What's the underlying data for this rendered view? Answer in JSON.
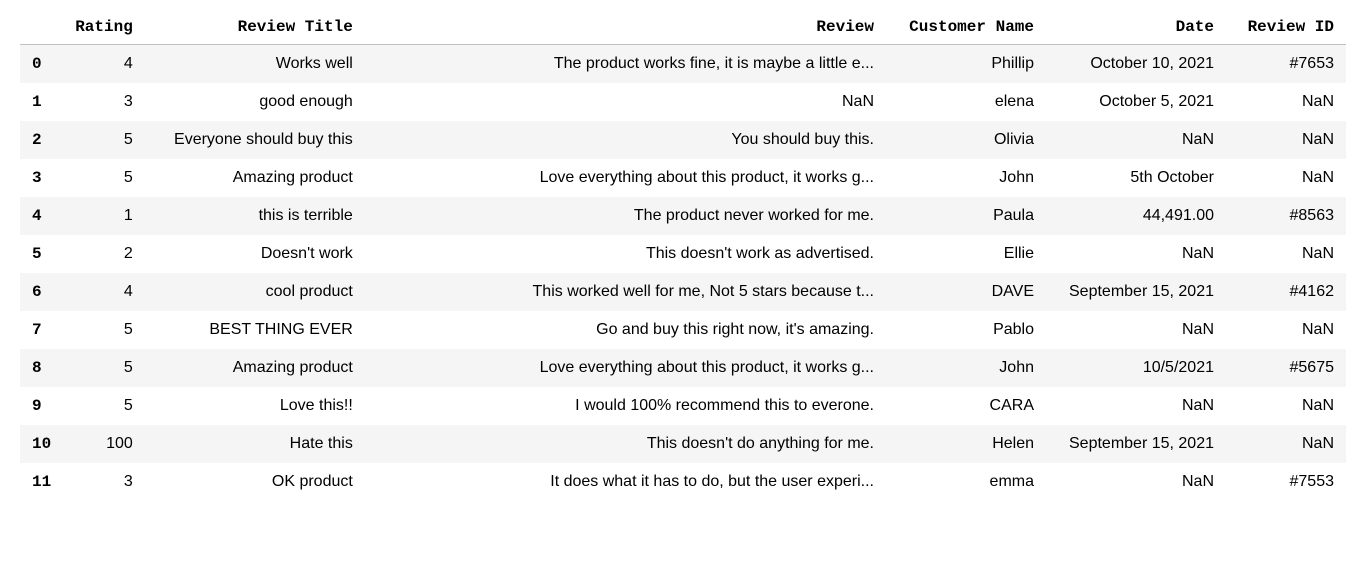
{
  "table": {
    "columns": [
      "",
      "Rating",
      "Review Title",
      "Review",
      "Customer Name",
      "Date",
      "Review ID"
    ],
    "rows": [
      {
        "idx": "0",
        "rating": "4",
        "title": "Works well",
        "review": "The product works fine, it is maybe a little e...",
        "name": "Phillip",
        "date": "October 10, 2021",
        "review_id": "#7653"
      },
      {
        "idx": "1",
        "rating": "3",
        "title": "good enough",
        "review": "NaN",
        "name": "elena",
        "date": "October 5, 2021",
        "review_id": "NaN"
      },
      {
        "idx": "2",
        "rating": "5",
        "title": "Everyone should buy this",
        "review": "You should buy this.",
        "name": "Olivia",
        "date": "NaN",
        "review_id": "NaN"
      },
      {
        "idx": "3",
        "rating": "5",
        "title": "Amazing product",
        "review": "Love everything about this product, it works g...",
        "name": "John",
        "date": "5th October",
        "review_id": "NaN"
      },
      {
        "idx": "4",
        "rating": "1",
        "title": "this is terrible",
        "review": "The product never worked for me.",
        "name": "Paula",
        "date": "44,491.00",
        "review_id": "#8563"
      },
      {
        "idx": "5",
        "rating": "2",
        "title": "Doesn't work",
        "review": "This doesn't work as advertised.",
        "name": "Ellie",
        "date": "NaN",
        "review_id": "NaN"
      },
      {
        "idx": "6",
        "rating": "4",
        "title": "cool product",
        "review": "This worked well for me, Not 5 stars because t...",
        "name": "DAVE",
        "date": "September 15, 2021",
        "review_id": "#4162"
      },
      {
        "idx": "7",
        "rating": "5",
        "title": "BEST THING EVER",
        "review": "Go and buy this right now, it's amazing.",
        "name": "Pablo",
        "date": "NaN",
        "review_id": "NaN"
      },
      {
        "idx": "8",
        "rating": "5",
        "title": "Amazing product",
        "review": "Love everything about this product, it works g...",
        "name": "John",
        "date": "10/5/2021",
        "review_id": "#5675"
      },
      {
        "idx": "9",
        "rating": "5",
        "title": "Love this!!",
        "review": "I would 100% recommend this to everone.",
        "name": "CARA",
        "date": "NaN",
        "review_id": "NaN"
      },
      {
        "idx": "10",
        "rating": "100",
        "title": "Hate this",
        "review": "This doesn't do anything for me.",
        "name": "Helen",
        "date": "September 15, 2021",
        "review_id": "NaN"
      },
      {
        "idx": "11",
        "rating": "3",
        "title": "OK product",
        "review": "It does what it has to do, but the user experi...",
        "name": "emma",
        "date": "NaN",
        "review_id": "#7553"
      }
    ]
  }
}
